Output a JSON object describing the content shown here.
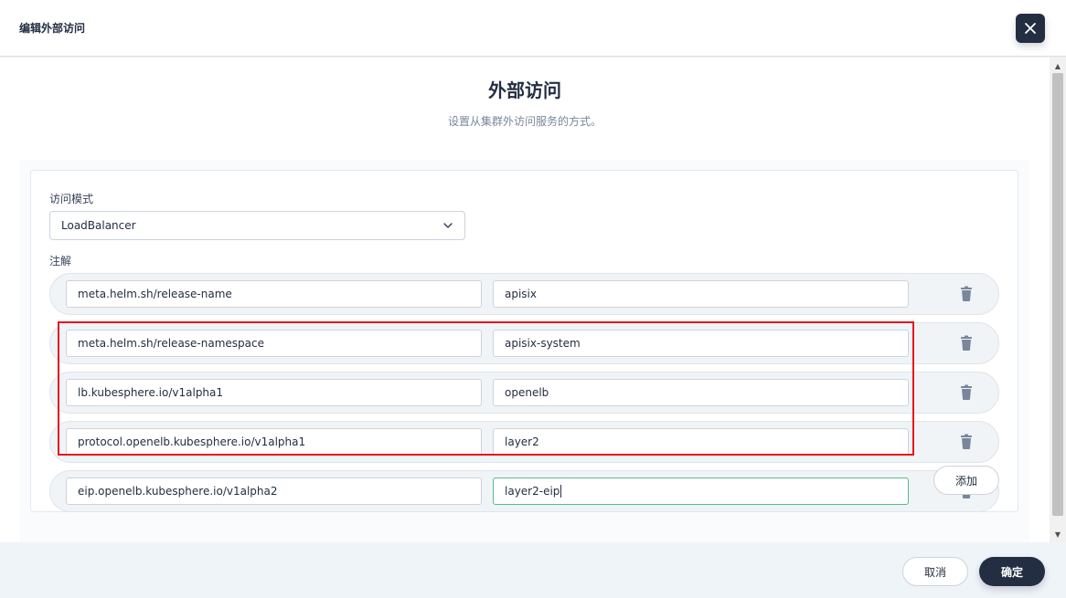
{
  "header": {
    "title": "编辑外部访问",
    "close_icon": "close-icon"
  },
  "section": {
    "title": "外部访问",
    "description": "设置从集群外访问服务的方式。"
  },
  "access_mode": {
    "label": "访问模式",
    "value": "LoadBalancer"
  },
  "annotations": {
    "label": "注解",
    "rows": [
      {
        "key": "meta.helm.sh/release-name",
        "value": "apisix"
      },
      {
        "key": "meta.helm.sh/release-namespace",
        "value": "apisix-system"
      },
      {
        "key": "lb.kubesphere.io/v1alpha1",
        "value": "openelb"
      },
      {
        "key": "protocol.openelb.kubesphere.io/v1alpha1",
        "value": "layer2"
      },
      {
        "key": "eip.openelb.kubesphere.io/v1alpha2",
        "value": "layer2-eip"
      }
    ],
    "add_label": "添加",
    "delete_icon": "trash-icon"
  },
  "footer": {
    "cancel_label": "取消",
    "ok_label": "确定"
  },
  "colors": {
    "primary": "#242e42",
    "highlight": "#e8141b",
    "focus": "#55bc8a"
  }
}
